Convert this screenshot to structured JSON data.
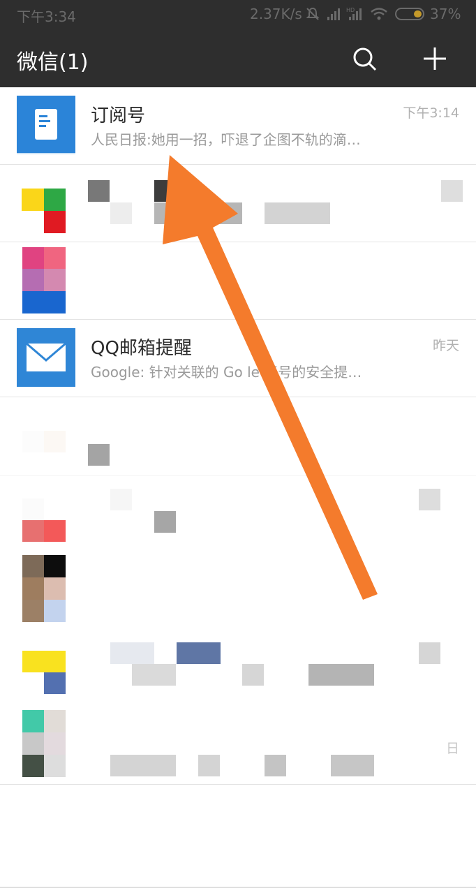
{
  "status": {
    "time": "下午3:34",
    "network_speed": "2.37K/s",
    "battery": "37%",
    "icons": [
      "bell-off-icon",
      "signal-icon",
      "hd-signal-icon",
      "wifi-icon",
      "battery-icon"
    ]
  },
  "header": {
    "title": "微信(1)",
    "icons": [
      "search-icon",
      "plus-icon"
    ]
  },
  "chats": [
    {
      "name": "订阅号",
      "preview": "人民日报:她用一招，吓退了企图不轨的滴…",
      "time": "下午3:14",
      "avatar": "subscription-icon"
    },
    {
      "name": "",
      "preview": "",
      "time": "",
      "avatar": "pixelated"
    },
    {
      "name": "",
      "preview": "",
      "time": "",
      "avatar": "pixelated"
    },
    {
      "name": "QQ邮箱提醒",
      "preview": "Google: 针对关联的 Go    le 帐号的安全提…",
      "time": "昨天",
      "avatar": "mail-icon"
    },
    {
      "name": "",
      "preview": "",
      "time": "",
      "avatar": "pixelated"
    },
    {
      "name": "",
      "preview": "",
      "time": "",
      "avatar": "pixelated"
    },
    {
      "name": "",
      "preview": "",
      "time": "",
      "avatar": "pixelated"
    },
    {
      "name": "",
      "preview": "",
      "time": "",
      "avatar": "pixelated"
    },
    {
      "name": "",
      "preview": "",
      "time": "日",
      "avatar": "pixelated"
    }
  ],
  "colors": {
    "header_bg": "#2e2e2e",
    "accent_blue": "#2b84d8",
    "arrow": "#f47b2c"
  }
}
